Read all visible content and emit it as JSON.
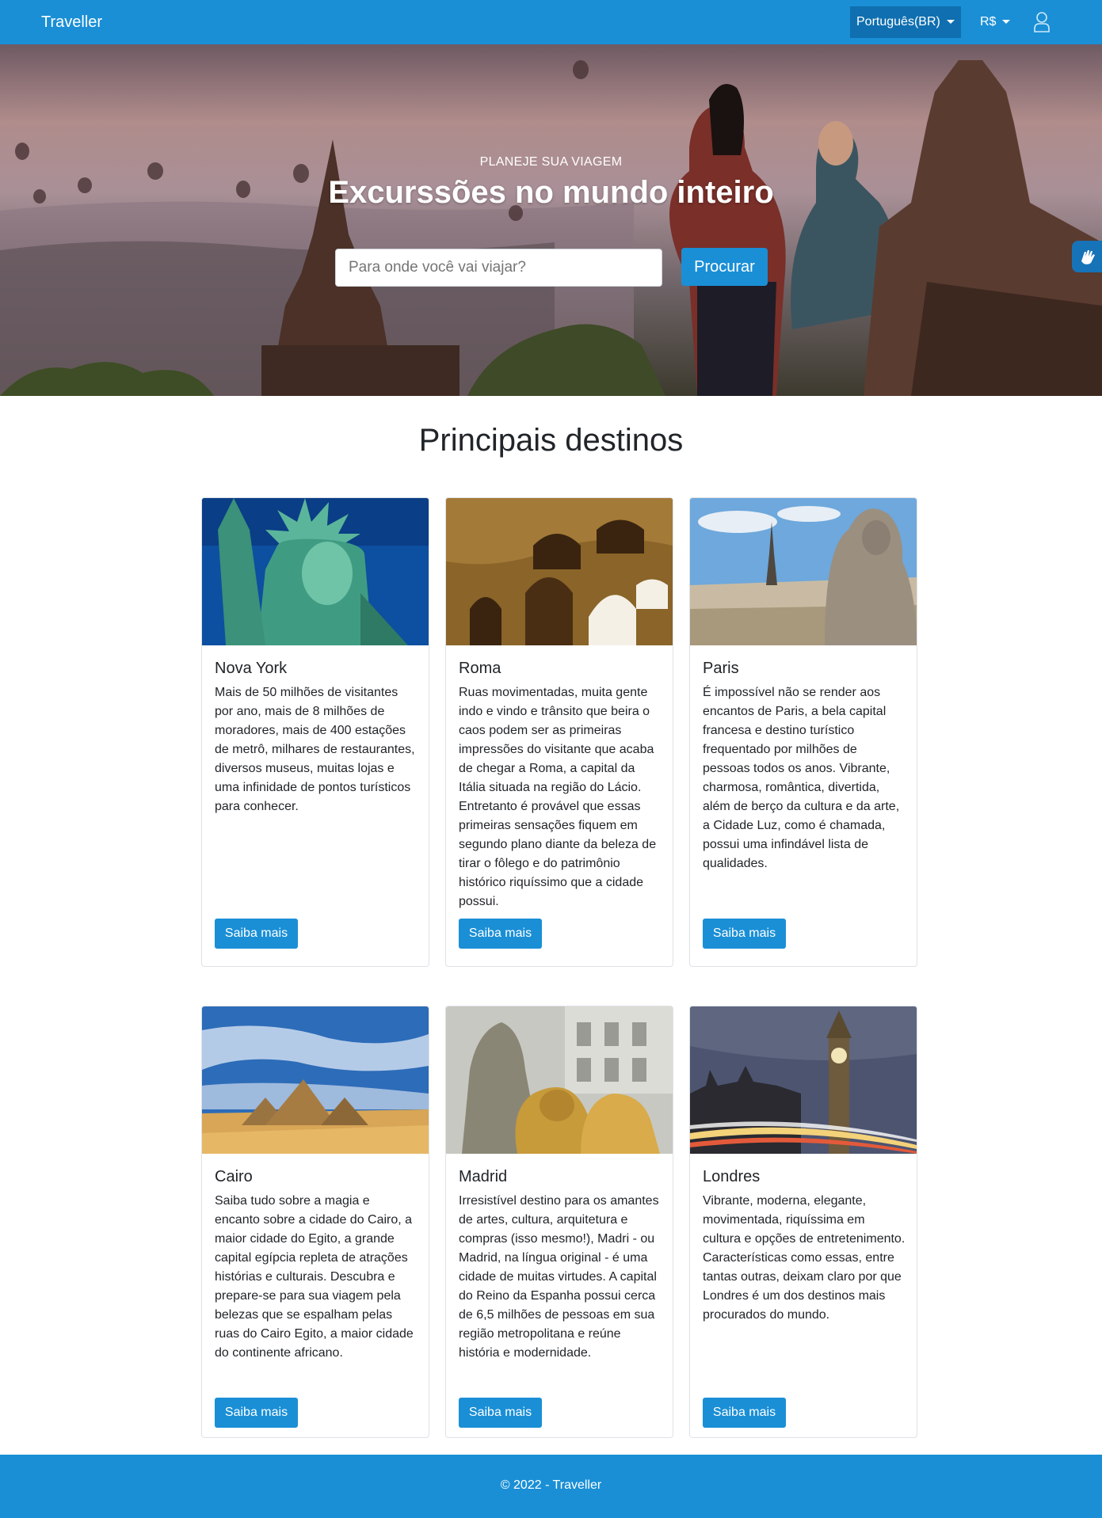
{
  "navbar": {
    "brand": "Traveller",
    "language": "Português(BR)",
    "currency": "R$",
    "user_icon": "user-icon"
  },
  "hero": {
    "subtitle": "PLANEJE SUA VIAGEM",
    "title": "Excurssões no mundo inteiro",
    "search_placeholder": "Para onde você vai viajar?",
    "search_button": "Procurar",
    "accessibility_icon": "hand-sign-icon"
  },
  "destinations": {
    "title": "Principais destinos",
    "cards": [
      {
        "name": "Nova York",
        "text": "Mais de 50 milhões de visitantes por ano, mais de 8 milhões de moradores, mais de 400 estações de metrô, milhares de restaurantes, diversos museus, muitas lojas e uma infinidade de pontos turísticos para conhecer.",
        "button": "Saiba mais"
      },
      {
        "name": "Roma",
        "text": "Ruas movimentadas, muita gente indo e vindo e trânsito que beira o caos podem ser as primeiras impressões do visitante que acaba de chegar a Roma, a capital da Itália situada na região do Lácio. Entretanto é provável que essas primeiras sensações fiquem em segundo plano diante da beleza de tirar o fôlego e do patrimônio histórico riquíssimo que a cidade possui.",
        "button": "Saiba mais"
      },
      {
        "name": "Paris",
        "text": "É impossível não se render aos encantos de Paris, a bela capital francesa e destino turístico frequentado por milhões de pessoas todos os anos. Vibrante, charmosa, romântica, divertida, além de berço da cultura e da arte, a Cidade Luz, como é chamada, possui uma infindável lista de qualidades.",
        "button": "Saiba mais"
      },
      {
        "name": "Cairo",
        "text": "Saiba tudo sobre a magia e encanto sobre a cidade do Cairo, a maior cidade do Egito, a grande capital egípcia repleta de atrações histórias e culturais. Descubra e prepare-se para sua viagem pela belezas que se espalham pelas ruas do Cairo Egito, a maior cidade do continente africano.",
        "button": "Saiba mais"
      },
      {
        "name": "Madrid",
        "text": "Irresistível destino para os amantes de artes, cultura, arquitetura e compras (isso mesmo!), Madri - ou Madrid, na língua original - é uma cidade de muitas virtudes. A capital do Reino da Espanha possui cerca de 6,5 milhões de pessoas em sua região metropolitana e reúne história e modernidade.",
        "button": "Saiba mais"
      },
      {
        "name": "Londres",
        "text": "Vibrante, moderna, elegante, movimentada, riquíssima em cultura e opções de entretenimento. Características como essas, entre tantas outras, deixam claro por que Londres é um dos destinos mais procurados do mundo.",
        "button": "Saiba mais"
      }
    ]
  },
  "footer": {
    "text": "© 2022 - Traveller"
  },
  "colors": {
    "primary": "#1a8fd6",
    "primary_dark": "#0f6fb0"
  }
}
